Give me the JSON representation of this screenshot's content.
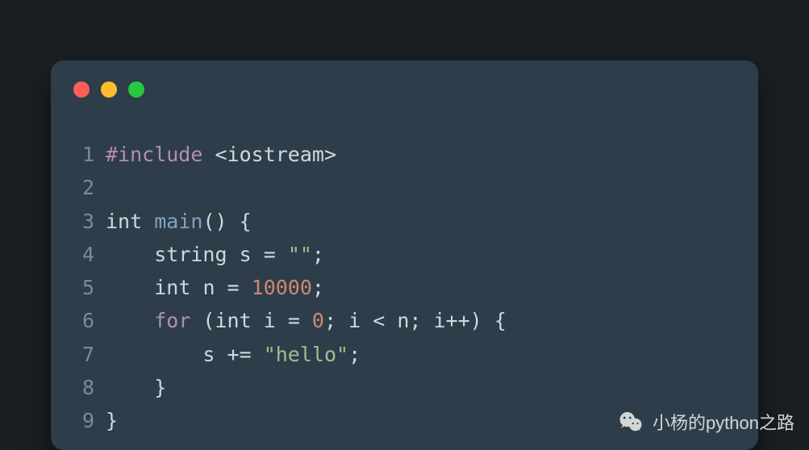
{
  "window": {
    "traffic_lights": [
      "red",
      "yellow",
      "green"
    ]
  },
  "code": {
    "lines": [
      {
        "num": 1,
        "tokens": [
          {
            "cls": "tok-directive",
            "t": "#include"
          },
          {
            "cls": "tok-punct",
            "t": " "
          },
          {
            "cls": "tok-include",
            "t": "<iostream>"
          }
        ]
      },
      {
        "num": 2,
        "tokens": []
      },
      {
        "num": 3,
        "tokens": [
          {
            "cls": "tok-type",
            "t": "int"
          },
          {
            "cls": "tok-punct",
            "t": " "
          },
          {
            "cls": "tok-funcname",
            "t": "main"
          },
          {
            "cls": "tok-punct",
            "t": "()"
          },
          {
            "cls": "tok-punct",
            "t": " {"
          }
        ]
      },
      {
        "num": 4,
        "tokens": [
          {
            "cls": "tok-punct",
            "t": "    "
          },
          {
            "cls": "tok-type",
            "t": "string"
          },
          {
            "cls": "tok-punct",
            "t": " "
          },
          {
            "cls": "tok-ident",
            "t": "s"
          },
          {
            "cls": "tok-op",
            "t": " = "
          },
          {
            "cls": "tok-string",
            "t": "\"\""
          },
          {
            "cls": "tok-punct",
            "t": ";"
          }
        ]
      },
      {
        "num": 5,
        "tokens": [
          {
            "cls": "tok-punct",
            "t": "    "
          },
          {
            "cls": "tok-type",
            "t": "int"
          },
          {
            "cls": "tok-punct",
            "t": " "
          },
          {
            "cls": "tok-ident",
            "t": "n"
          },
          {
            "cls": "tok-op",
            "t": " = "
          },
          {
            "cls": "tok-number",
            "t": "10000"
          },
          {
            "cls": "tok-punct",
            "t": ";"
          }
        ]
      },
      {
        "num": 6,
        "tokens": [
          {
            "cls": "tok-punct",
            "t": "    "
          },
          {
            "cls": "tok-keyword",
            "t": "for"
          },
          {
            "cls": "tok-punct",
            "t": " ("
          },
          {
            "cls": "tok-type",
            "t": "int"
          },
          {
            "cls": "tok-punct",
            "t": " "
          },
          {
            "cls": "tok-ident",
            "t": "i"
          },
          {
            "cls": "tok-op",
            "t": " = "
          },
          {
            "cls": "tok-number",
            "t": "0"
          },
          {
            "cls": "tok-punct",
            "t": "; "
          },
          {
            "cls": "tok-ident",
            "t": "i"
          },
          {
            "cls": "tok-op",
            "t": " < "
          },
          {
            "cls": "tok-ident",
            "t": "n"
          },
          {
            "cls": "tok-punct",
            "t": "; "
          },
          {
            "cls": "tok-ident",
            "t": "i"
          },
          {
            "cls": "tok-op",
            "t": "++"
          },
          {
            "cls": "tok-punct",
            "t": ") {"
          }
        ]
      },
      {
        "num": 7,
        "tokens": [
          {
            "cls": "tok-punct",
            "t": "        "
          },
          {
            "cls": "tok-ident",
            "t": "s"
          },
          {
            "cls": "tok-op",
            "t": " += "
          },
          {
            "cls": "tok-string",
            "t": "\"hello\""
          },
          {
            "cls": "tok-punct",
            "t": ";"
          }
        ]
      },
      {
        "num": 8,
        "tokens": [
          {
            "cls": "tok-punct",
            "t": "    }"
          }
        ]
      },
      {
        "num": 9,
        "tokens": [
          {
            "cls": "tok-punct",
            "t": "}"
          }
        ]
      }
    ]
  },
  "watermark": {
    "icon": "wechat-icon",
    "text": "小杨的python之路"
  }
}
